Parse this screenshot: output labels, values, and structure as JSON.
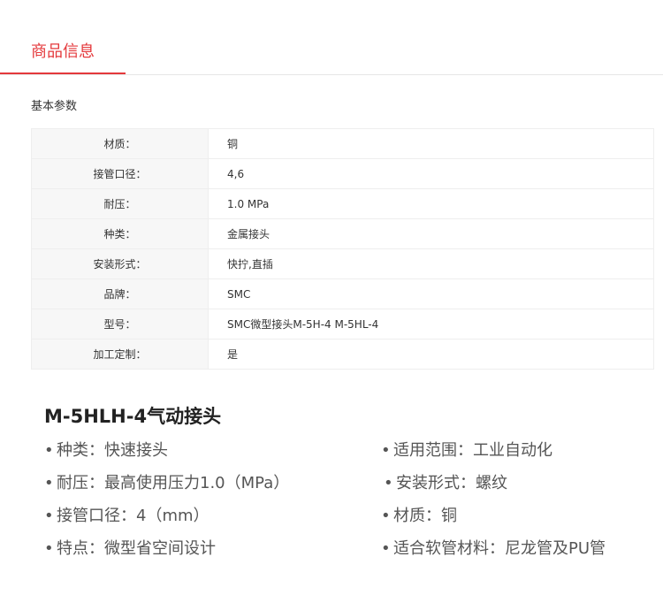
{
  "tab": {
    "label": "商品信息"
  },
  "section": {
    "title": "基本参数"
  },
  "params": [
    {
      "label": "材质：",
      "value": "铜"
    },
    {
      "label": "接管口径：",
      "value": "4,6"
    },
    {
      "label": "耐压：",
      "value": "1.0 MPa"
    },
    {
      "label": "种类：",
      "value": "金属接头"
    },
    {
      "label": "安装形式：",
      "value": "快拧,直插"
    },
    {
      "label": "品牌：",
      "value": "SMC"
    },
    {
      "label": "型号：",
      "value": "SMC微型接头M-5H-4 M-5HL-4"
    },
    {
      "label": "加工定制：",
      "value": "是"
    }
  ],
  "product": {
    "title": "M-5HLH-4气动接头"
  },
  "features": {
    "bullet": "•",
    "left": [
      "种类：快速接头",
      "耐压：最高使用压力1.0（MPa）",
      "接管口径：4（mm）",
      "特点：微型省空间设计"
    ],
    "right": [
      "适用范围：工业自动化",
      "安装形式：螺纹",
      "材质：铜",
      "适合软管材料：尼龙管及PU管"
    ]
  },
  "colors": {
    "accent": "#e4393c",
    "label_bg": "#f7f7f7",
    "border": "#eeeeee"
  }
}
